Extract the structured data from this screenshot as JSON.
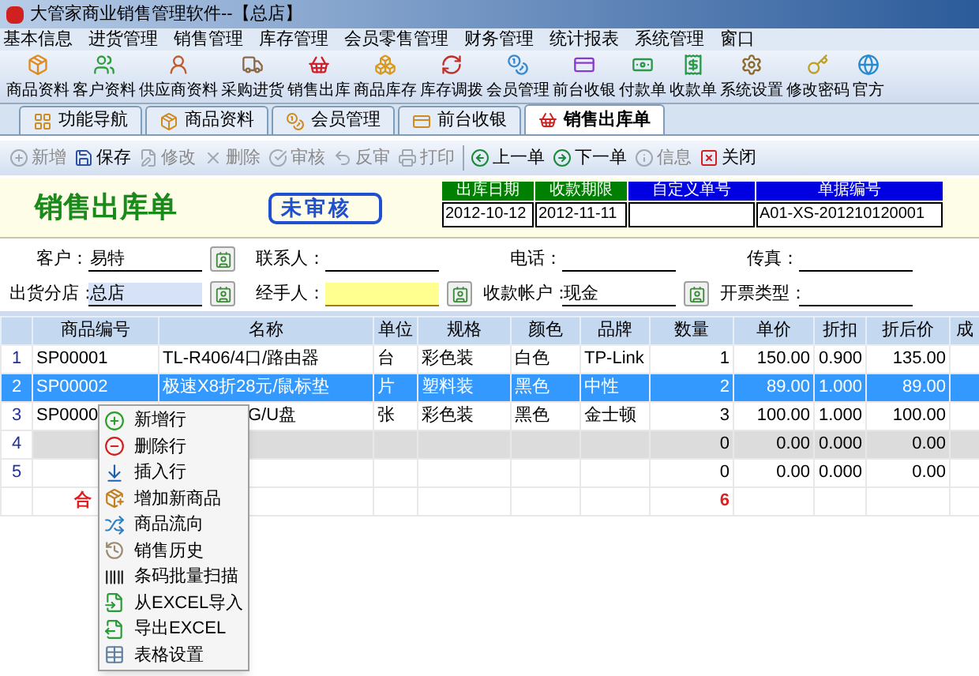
{
  "window": {
    "title": "大管家商业销售管理软件--【总店】"
  },
  "menu": [
    "基本信息",
    "进货管理",
    "销售管理",
    "库存管理",
    "会员零售管理",
    "财务管理",
    "统计报表",
    "系统管理",
    "窗口"
  ],
  "toolbar": [
    "商品资料",
    "客户资料",
    "供应商资料",
    "采购进货",
    "销售出库",
    "商品库存",
    "库存调拨",
    "会员管理",
    "前台收银",
    "付款单",
    "收款单",
    "系统设置",
    "修改密码",
    "官方"
  ],
  "tabs": [
    {
      "label": "功能导航",
      "selected": false
    },
    {
      "label": "商品资料",
      "selected": false
    },
    {
      "label": "会员管理",
      "selected": false
    },
    {
      "label": "前台收银",
      "selected": false
    },
    {
      "label": "销售出库单",
      "selected": true
    }
  ],
  "actions": [
    {
      "label": "新增",
      "disabled": true
    },
    {
      "label": "保存",
      "disabled": false
    },
    {
      "label": "修改",
      "disabled": true
    },
    {
      "label": "删除",
      "disabled": true
    },
    {
      "label": "审核",
      "disabled": true
    },
    {
      "label": "反审",
      "disabled": true
    },
    {
      "label": "打印",
      "disabled": true
    },
    {
      "label": "上一单",
      "disabled": false
    },
    {
      "label": "下一单",
      "disabled": false
    },
    {
      "label": "信息",
      "disabled": true
    },
    {
      "label": "关闭",
      "disabled": false
    }
  ],
  "form": {
    "title": "销售出库单",
    "status": "未审核",
    "header_fields": [
      {
        "label": "出库日期",
        "value": "2012-10-12",
        "color": "#008000"
      },
      {
        "label": "收款期限",
        "value": "2012-11-11",
        "color": "#008000"
      },
      {
        "label": "自定义单号",
        "color": "#0000e0"
      },
      {
        "label": "单据编号",
        "value": "A01-XS-201210120001",
        "color": "#0000e0"
      }
    ]
  },
  "fields": [
    {
      "label": "客户：",
      "value": "易特",
      "kind": "lookup",
      "focused": false,
      "required": false
    },
    {
      "label": "联系人：",
      "kind": "plain",
      "focused": false,
      "required": false
    },
    {
      "label": "电话：",
      "kind": "plain",
      "focused": false,
      "required": false
    },
    {
      "label": "传真：",
      "kind": "plain",
      "focused": false,
      "required": false
    },
    {
      "label": "出货分店：",
      "value": "总店",
      "kind": "lookup",
      "focused": true,
      "required": false
    },
    {
      "label": "经手人：",
      "kind": "lookup",
      "focused": false,
      "required": true
    },
    {
      "label": "收款帐户：",
      "value": "现金",
      "kind": "lookup",
      "focused": false,
      "required": false
    },
    {
      "label": "开票类型：",
      "kind": "plain",
      "focused": false,
      "required": false
    }
  ],
  "table": {
    "columns": [
      "",
      "商品编号",
      "名称",
      "单位",
      "规格",
      "颜色",
      "品牌",
      "数量",
      "单价",
      "折扣",
      "折后价",
      "成"
    ],
    "rows": [
      {
        "kind": "item",
        "selected": false,
        "cells": [
          "1",
          "SP00001",
          "TL-R406/4口/路由器",
          "台",
          "彩色装",
          "白色",
          "TP-Link",
          "1",
          "150.00",
          "0.900",
          "135.00"
        ]
      },
      {
        "kind": "item",
        "selected": true,
        "cells": [
          "2",
          "SP00002",
          "极速X8折28元/鼠标垫",
          "片",
          "塑料装",
          "黑色",
          "中性",
          "2",
          "89.00",
          "1.000",
          "89.00"
        ]
      },
      {
        "kind": "covered",
        "selected": false,
        "cells": [
          "3",
          "SP0000",
          "G/U盘",
          "张",
          "彩色装",
          "黑色",
          "金士顿",
          "3",
          "100.00",
          "1.000",
          "100.00"
        ]
      },
      {
        "kind": "new",
        "selected": false,
        "cells": [
          "4",
          "",
          "",
          "",
          "",
          "",
          "",
          "0",
          "0.00",
          "0.000",
          "0.00"
        ]
      },
      {
        "kind": "item",
        "selected": false,
        "cells": [
          "5",
          "",
          "",
          "",
          "",
          "",
          "",
          "0",
          "0.00",
          "0.000",
          "0.00"
        ]
      },
      {
        "kind": "total",
        "selected": false,
        "cells": [
          "",
          "合",
          "",
          "",
          "",
          "",
          "",
          "6",
          "",
          "",
          ""
        ]
      }
    ]
  },
  "context_menu": [
    "新增行",
    "删除行",
    "插入行",
    "增加新商品",
    "商品流向",
    "销售历史",
    "条码批量扫描",
    "从EXCEL导入",
    "导出EXCEL",
    "表格设置"
  ]
}
